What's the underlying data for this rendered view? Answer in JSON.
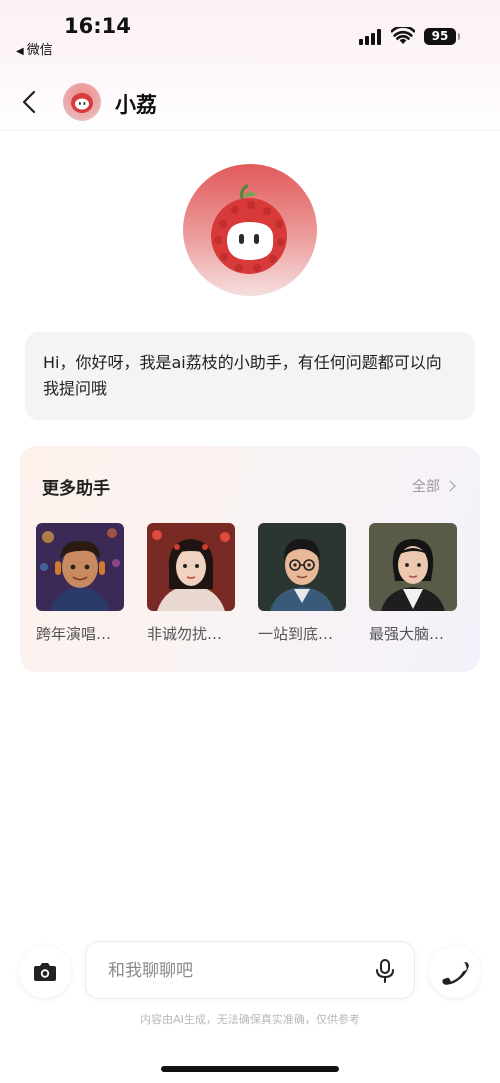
{
  "status_bar": {
    "time": "16:14",
    "back_app": "微信",
    "battery": "95"
  },
  "header": {
    "title": "小荔"
  },
  "greeting": "Hi，你好呀，我是ai荔枝的小助手，有任何问题都可以向我提问哦",
  "assistants": {
    "title": "更多助手",
    "all_label": "全部",
    "items": [
      {
        "name": "跨年演唱…"
      },
      {
        "name": "非诚勿扰…"
      },
      {
        "name": "一站到底…"
      },
      {
        "name": "最强大脑…"
      }
    ]
  },
  "input": {
    "placeholder": "和我聊聊吧",
    "value": ""
  },
  "disclaimer": "内容由AI生成，无法确保真实准确，仅供参考",
  "icons": {
    "back": "chevron-left-icon",
    "camera": "camera-icon",
    "mic": "microphone-icon",
    "call": "phone-icon",
    "all_chevron": "chevron-right-icon"
  },
  "colors": {
    "brand_red": "#e25a5a",
    "card_bg": "#faf3f3",
    "bubble_bg": "#f4f4f5"
  }
}
